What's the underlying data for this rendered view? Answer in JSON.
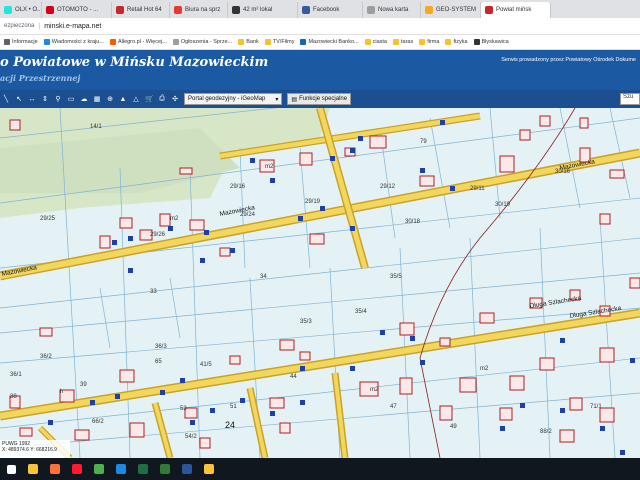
{
  "browser": {
    "tabs": [
      {
        "label": "OLX • O...",
        "color": "#23e5db"
      },
      {
        "label": "OTOMOTO - ...",
        "color": "#d0021b"
      },
      {
        "label": "Retail Hot 64",
        "color": "#c62828"
      },
      {
        "label": "Biura na sprz",
        "color": "#e53935"
      },
      {
        "label": "42 m² lokal",
        "color": "#333333"
      },
      {
        "label": "Facebook",
        "color": "#3b5998"
      },
      {
        "label": "Nowa karta",
        "color": "#9e9e9e"
      },
      {
        "label": "GEO-SYSTEM",
        "color": "#f9a825"
      },
      {
        "label": "Powiat mińsk",
        "color": "#c62828"
      }
    ],
    "address": {
      "security": "ezpieczona",
      "url": "minski.e-mapa.net"
    },
    "bookmarks": [
      {
        "label": "Informacje",
        "color": "#5f6368"
      },
      {
        "label": "Wiadomości z kraju...",
        "color": "#1e88e5"
      },
      {
        "label": "Allegro.pl - Więcej...",
        "color": "#ff5a00"
      },
      {
        "label": "Ogłoszenia - Sprze...",
        "color": "#9e9e9e"
      },
      {
        "label": "Bank",
        "color": "#fbc02d"
      },
      {
        "label": "TV/Filmy",
        "color": "#fbc02d"
      },
      {
        "label": "Mazowiecki Banko...",
        "color": "#1565c0"
      },
      {
        "label": "ciasta",
        "color": "#fbc02d"
      },
      {
        "label": "taras",
        "color": "#fbc02d"
      },
      {
        "label": "firma",
        "color": "#fbc02d"
      },
      {
        "label": "fizyka",
        "color": "#fbc02d"
      },
      {
        "label": "Błyskawica",
        "color": "#333333"
      }
    ]
  },
  "header": {
    "title": "o Powiatowe w Mińsku Mazowieckim",
    "subtitle": "acji Przestrzennej",
    "note": "Serwis prowadzony przez Powiatowy Ośrodek Dokume"
  },
  "toolbar": {
    "portal_label": "Portal geodezyjny - iGeoMap",
    "special_label": "Funkcje specjalne",
    "search_label": "Szu"
  },
  "map": {
    "street_labels": [
      "Mazowiecka",
      "Mazowiecka",
      "Długa Szlachecka",
      "Długa Szlachecka",
      "Mazowiecka"
    ],
    "parcel_labels": [
      "14/1",
      "79",
      "29/25",
      "29/24",
      "29/26",
      "29/19",
      "29/16",
      "29/12",
      "29/11",
      "30/18",
      "30/19",
      "30/16",
      "34",
      "33",
      "35/5",
      "35/4",
      "35/3",
      "36/3",
      "36/2",
      "36/1",
      "41/5",
      "54/2",
      "53",
      "24",
      "65",
      "66/2",
      "71/1",
      "51",
      "47",
      "44",
      "39",
      "38",
      "49",
      "88/2",
      "m2",
      "m2",
      "m2",
      "m2",
      "h"
    ],
    "scale_label": "PUWG 1992",
    "coords": "X: 489374.6   Y: 668216.9"
  },
  "taskbar": {
    "icons": [
      {
        "name": "windows-icon",
        "color": "#ffffff"
      },
      {
        "name": "file-explorer-icon",
        "color": "#f9c33c"
      },
      {
        "name": "firefox-icon",
        "color": "#ff7139"
      },
      {
        "name": "opera-icon",
        "color": "#ff1b2d"
      },
      {
        "name": "chrome-icon",
        "color": "#4caf50"
      },
      {
        "name": "photos-icon",
        "color": "#1e88e5"
      },
      {
        "name": "excel-icon",
        "color": "#1d6f42"
      },
      {
        "name": "app-icon",
        "color": "#2e7d32"
      },
      {
        "name": "word-icon",
        "color": "#2b579a"
      },
      {
        "name": "mail-icon",
        "color": "#f9c33c"
      }
    ]
  }
}
